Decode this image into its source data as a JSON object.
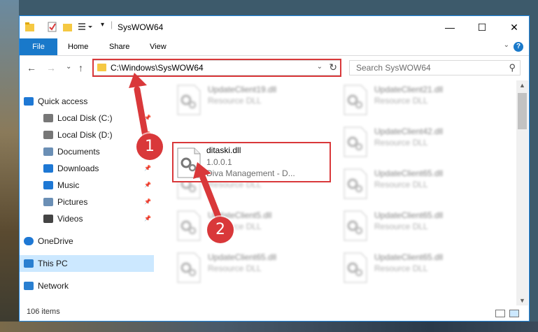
{
  "window": {
    "title": "SysWOW64",
    "buttons": {
      "minimize": "—",
      "maximize": "☐",
      "close": "✕"
    }
  },
  "ribbon": {
    "file_tab": "File",
    "tabs": [
      "Home",
      "Share",
      "View"
    ],
    "help": "?"
  },
  "nav": {
    "address": "C:\\Windows\\SysWOW64",
    "search_placeholder": "Search SysWOW64"
  },
  "sidebar": {
    "items": [
      {
        "label": "Quick access",
        "icon": "star-icon",
        "pinned": false
      },
      {
        "label": "Local Disk (C:)",
        "icon": "drive-icon",
        "pinned": true
      },
      {
        "label": "Local Disk (D:)",
        "icon": "drive-icon",
        "pinned": true
      },
      {
        "label": "Documents",
        "icon": "document-icon",
        "pinned": true
      },
      {
        "label": "Downloads",
        "icon": "download-icon",
        "pinned": true
      },
      {
        "label": "Music",
        "icon": "music-icon",
        "pinned": true
      },
      {
        "label": "Pictures",
        "icon": "picture-icon",
        "pinned": true
      },
      {
        "label": "Videos",
        "icon": "video-icon",
        "pinned": true
      },
      {
        "label": "OneDrive",
        "icon": "cloud-icon",
        "pinned": false
      },
      {
        "label": "This PC",
        "icon": "computer-icon",
        "pinned": false,
        "selected": true
      },
      {
        "label": "Network",
        "icon": "network-icon",
        "pinned": false
      }
    ]
  },
  "files": {
    "left_column": [
      {
        "name": "UpdateClient19.dll",
        "desc": "Resource DLL"
      },
      {
        "name": "UpdateClient5.dll",
        "desc": "Resource DLL"
      },
      {
        "name": "UpdateClient5.dll",
        "desc": "Resource DLL"
      },
      {
        "name": "UpdateClient65.dll",
        "desc": "Resource DLL"
      }
    ],
    "right_column": [
      {
        "name": "UpdateClient21.dll",
        "desc": "Resource DLL"
      },
      {
        "name": "UpdateClient42.dll",
        "desc": "Resource DLL"
      },
      {
        "name": "UpdateClient65.dll",
        "desc": "Resource DLL"
      },
      {
        "name": "UpdateClient65.dll",
        "desc": "Resource DLL"
      },
      {
        "name": "UpdateClient65.dll",
        "desc": "Resource DLL"
      }
    ],
    "highlighted": {
      "name": "ditaski.dll",
      "version": "1.0.0.1",
      "company": "Diva Management - D..."
    }
  },
  "status": {
    "item_count": "106 items"
  },
  "annotations": {
    "step1": "1",
    "step2": "2",
    "color": "#d9383a"
  }
}
